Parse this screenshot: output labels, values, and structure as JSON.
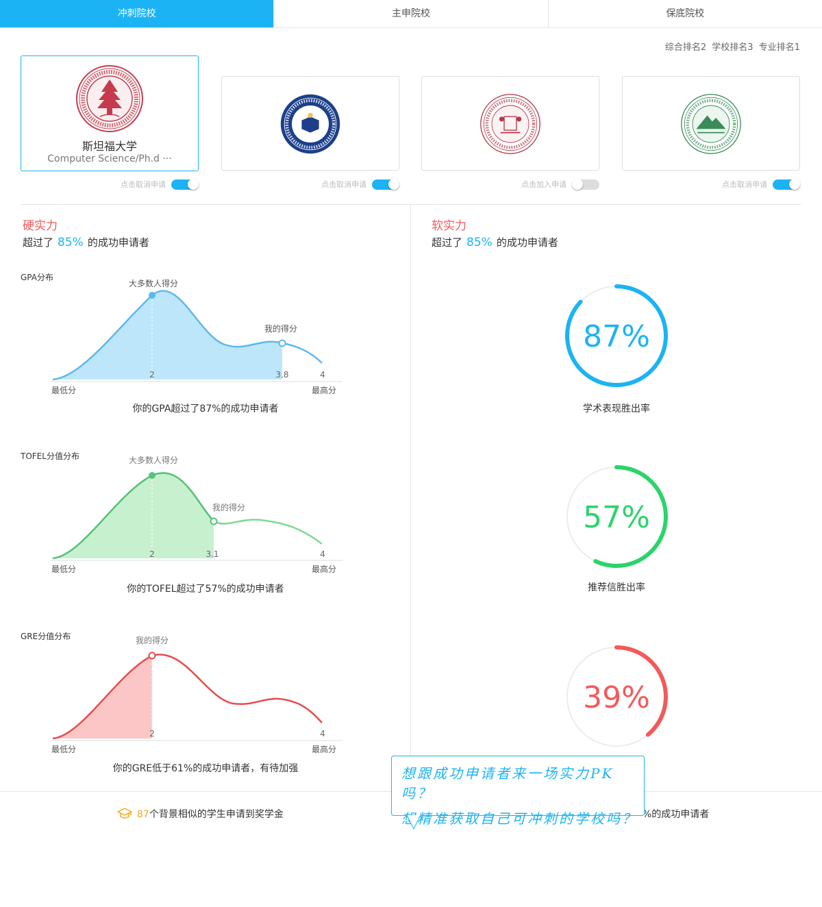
{
  "tabs": [
    {
      "label": "冲刺院校",
      "active": true
    },
    {
      "label": "主申院校",
      "active": false
    },
    {
      "label": "保底院校",
      "active": false
    }
  ],
  "rankings": {
    "overall": "综合排名2",
    "school": "学校排名3",
    "major": "专业排名1"
  },
  "schools": [
    {
      "name": "斯坦福大学",
      "major": "Computer Science/Ph.d ···",
      "toggle_label": "点击取消申请",
      "applied": true,
      "seal_color": "#c63b4c"
    },
    {
      "toggle_label": "点击取消申请",
      "applied": true,
      "seal_color": "#1d3f8a"
    },
    {
      "toggle_label": "点击加入申请",
      "applied": false,
      "seal_color": "#b23a4a"
    },
    {
      "toggle_label": "点击取消申请",
      "applied": true,
      "seal_color": "#3b8b5a"
    }
  ],
  "hard": {
    "title": "硬实力",
    "prefix": "超过了",
    "percent": "85%",
    "suffix": "的成功申请者"
  },
  "soft": {
    "title": "软实力",
    "prefix": "超过了",
    "percent": "85%",
    "suffix": "的成功申请者"
  },
  "distributions": [
    {
      "label": "GPA分布",
      "peak_label": "大多数人得分",
      "my_label": "我的得分",
      "peak_value": "2",
      "my_value": "3.8",
      "max_value": "4",
      "min_text": "最低分",
      "max_text": "最高分",
      "caption": "你的GPA超过了87%的成功申请者",
      "color": "#5bb8ee",
      "fill": "#bde6fb"
    },
    {
      "label": "TOFEL分值分布",
      "peak_label": "大多数人得分",
      "my_label": "我的得分",
      "peak_value": "2",
      "my_value": "3.1",
      "max_value": "4",
      "min_text": "最低分",
      "max_text": "最高分",
      "caption": "你的TOFEL超过了57%的成功申请者",
      "color": "#58c27a",
      "fill": "#c7f0cf"
    },
    {
      "label": "GRE分值分布",
      "peak_label": "我的得分",
      "peak_value": "2",
      "max_value": "4",
      "min_text": "最低分",
      "max_text": "最高分",
      "caption": "你的GRE低于61%的成功申请者，有待加强",
      "color": "#e84c4c",
      "fill": "#fdc6c6"
    }
  ],
  "rings": [
    {
      "value": 87,
      "text": "87%",
      "label": "学术表现胜出率",
      "color": "#1cb3f4"
    },
    {
      "value": 57,
      "text": "57%",
      "label": "推荐信胜出率",
      "color": "#2bd46b"
    },
    {
      "value": 39,
      "text": "39%",
      "label": "",
      "color": "#f4595a"
    }
  ],
  "footer": {
    "count": "87",
    "scholarship_text": "个背景相似的学生申请到奖学金",
    "right_text": "%的成功申请者"
  },
  "bubble": {
    "line1": "想跟成功申请者来一场实力PK吗？",
    "line2": "想精准获取自己可冲刺的学校吗？"
  }
}
